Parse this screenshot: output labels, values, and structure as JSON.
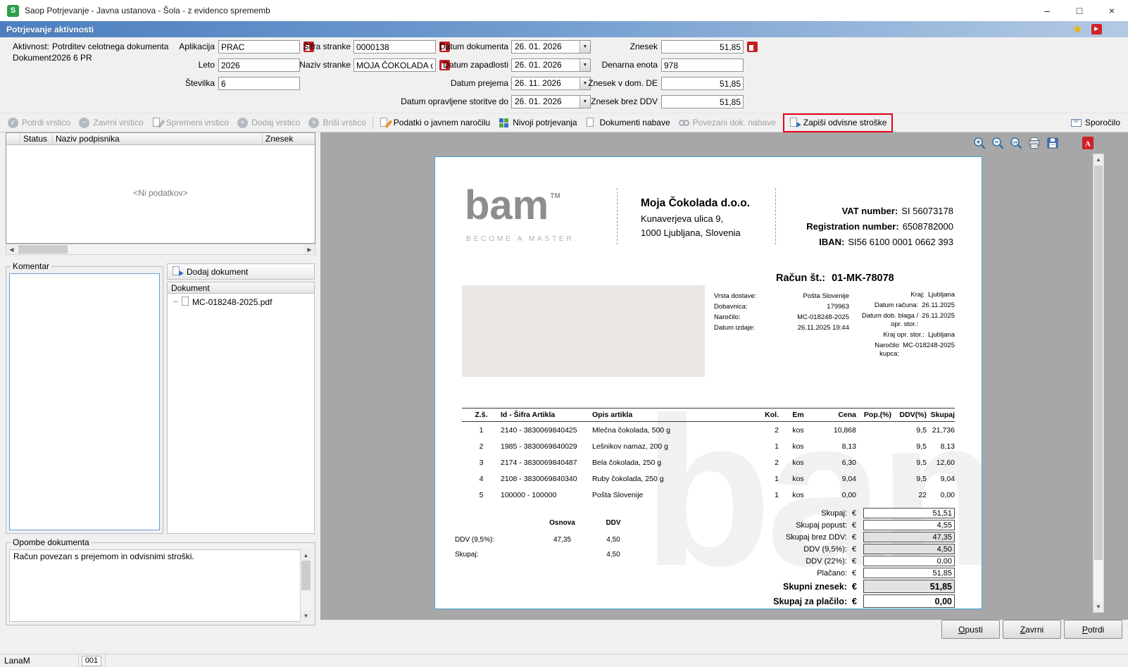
{
  "window": {
    "title": "Saop Potrjevanje - Javna ustanova - Šola - z evidenco sprememb",
    "logo_letter": "S"
  },
  "icons": {
    "minimize": "–",
    "maximize": "□",
    "close": "×",
    "star": "★",
    "dropdown": "▼",
    "check": "✓",
    "minus": "−",
    "plus": "+",
    "cross": "×",
    "up": "▲",
    "down": "▼",
    "left": "◀",
    "right": "▶"
  },
  "activity_bar": {
    "title": "Potrjevanje aktivnosti"
  },
  "form": {
    "aktivnost_label": "Aktivnost:",
    "aktivnost_value": "Potrditev celotnega dokumenta",
    "dokument_label": "Dokument:",
    "dokument_value": "2026 6 PR",
    "aplikacija_label": "Aplikacija",
    "aplikacija_value": "PRAC",
    "leto_label": "Leto",
    "leto_value": "2026",
    "stevilka_label": "Številka",
    "stevilka_value": "6",
    "sifra_stranke_label": "Šifra stranke",
    "sifra_stranke_value": "0000138",
    "naziv_stranke_label": "Naziv stranke",
    "naziv_stranke_value": "MOJA ČOKOLADA d.o.o.",
    "datum_dokumenta_label": "Datum dokumenta",
    "datum_dokumenta_value": "26. 01. 2026",
    "datum_zapadlosti_label": "Datum zapadlosti",
    "datum_zapadlosti_value": "26. 01. 2026",
    "datum_prejema_label": "Datum prejema",
    "datum_prejema_value": "26. 11. 2026",
    "datum_opravljene_label": "Datum opravljene storitve do",
    "datum_opravljene_value": "26. 01. 2026",
    "znesek_label": "Znesek",
    "znesek_value": "51,85",
    "denarna_enota_label": "Denarna enota",
    "denarna_enota_value": "978",
    "znesek_dom_label": "Znesek v dom. DE",
    "znesek_dom_value": "51,85",
    "znesek_brez_ddv_label": "Znesek brez DDV",
    "znesek_brez_ddv_value": "51,85"
  },
  "toolbar": {
    "items": [
      {
        "label": "Potrdi vrstico"
      },
      {
        "label": "Zavrni vrstico"
      },
      {
        "label": "Spremeni vrstico"
      },
      {
        "label": "Dodaj vrstico"
      },
      {
        "label": "Briši vrstico"
      },
      {
        "label": "Podatki o javnem naročilu"
      },
      {
        "label": "Nivoji potrjevanja"
      },
      {
        "label": "Dokumenti nabave"
      },
      {
        "label": "Povezani dok. nabave"
      },
      {
        "label": "Zapiši odvisne stroške"
      }
    ],
    "message_label": "Sporočilo"
  },
  "signers": {
    "columns": [
      "Status",
      "Naziv podpisnika",
      "Znesek"
    ],
    "empty_text": "<Ni podatkov>"
  },
  "komentar": {
    "label": "Komentar",
    "value": ""
  },
  "documents": {
    "add_button_label": "Dodaj dokument",
    "column_header": "Dokument",
    "files": [
      "MC-018248-2025.pdf"
    ]
  },
  "opombe": {
    "label": "Opombe dokumenta",
    "text": "Račun povezan s prejemom in odvisnimi stroški."
  },
  "invoice": {
    "logo": {
      "text": "bam",
      "tm": "TM",
      "tagline": "BECOME A MASTER"
    },
    "supplier": {
      "name": "Moja Čokolada d.o.o.",
      "street": "Kunaverjeva ulica 9,",
      "city": "1000 Ljubljana, Slovenia"
    },
    "registry": [
      {
        "label": "VAT number:",
        "value": "SI 56073178"
      },
      {
        "label": "Registration number:",
        "value": "6508782000"
      },
      {
        "label": "IBAN:",
        "value": "SI56 6100 0001 0662 393"
      }
    ],
    "number_label": "Račun št.:",
    "number": "01-MK-78078",
    "meta_left": [
      {
        "label": "Vrsta dostave:",
        "value": "Pošta Slovenije"
      },
      {
        "label": "Dobavnica:",
        "value": "179963"
      },
      {
        "label": "Naročilo:",
        "value": "MC-018248-2025"
      },
      {
        "label": "Datum izdaje:",
        "value": "26.11.2025 19:44"
      }
    ],
    "meta_right": [
      {
        "label": "Kraj:",
        "value": "Ljubljana"
      },
      {
        "label": "Datum računa:",
        "value": "26.11.2025"
      },
      {
        "label": "Datum dob. blaga / opr. stor.:",
        "value": "26.11.2025"
      },
      {
        "label": "Kraj opr. stor.:",
        "value": "Ljubljana"
      },
      {
        "label": "Naročilo kupca:",
        "value": "MC-018248-2025"
      }
    ],
    "items": {
      "columns": [
        "Z.š.",
        "Id - Šifra Artikla",
        "Opis artikla",
        "Kol.",
        "Em",
        "Cena",
        "Pop.(%)",
        "DDV(%)",
        "Skupaj"
      ],
      "rows": [
        [
          "1",
          "2140 - 3830069840425",
          "Mlečna čokolada, 500 g",
          "2",
          "kos",
          "10,868",
          "",
          "9,5",
          "21,736"
        ],
        [
          "2",
          "1985 - 3830069840029",
          "Lešnikov namaz, 200 g",
          "1",
          "kos",
          "8,13",
          "",
          "9,5",
          "8,13"
        ],
        [
          "3",
          "2174 - 3830069840487",
          "Bela čokolada, 250 g",
          "2",
          "kos",
          "6,30",
          "",
          "9,5",
          "12,60"
        ],
        [
          "4",
          "2108 - 3830069840340",
          "Ruby čokolada, 250 g",
          "1",
          "kos",
          "9,04",
          "",
          "9,5",
          "9,04"
        ],
        [
          "5",
          "100000 - 100000",
          "Pošta Slovenije",
          "1",
          "kos",
          "0,00",
          "",
          "22",
          "0,00"
        ]
      ]
    },
    "vat_table": {
      "osnova_header": "Osnova",
      "ddv_header": "DDV",
      "rows": [
        {
          "label": "DDV (9,5%):",
          "osnova": "47,35",
          "ddv": "4,50"
        },
        {
          "label": "Skupaj:",
          "osnova": "",
          "ddv": "4,50"
        }
      ]
    },
    "totals": [
      {
        "label": "Skupaj:",
        "currency": "€",
        "value": "51,51"
      },
      {
        "label": "Skupaj popust:",
        "currency": "€",
        "value": "4,55"
      },
      {
        "label": "Skupaj brez DDV:",
        "currency": "€",
        "value": "47,35"
      },
      {
        "label": "DDV (9,5%):",
        "currency": "€",
        "value": "4,50"
      },
      {
        "label": "DDV (22%):",
        "currency": "€",
        "value": "0,00"
      },
      {
        "label": "Plačano:",
        "currency": "€",
        "value": "51,85"
      },
      {
        "label": "Skupni znesek:",
        "currency": "€",
        "value": "51,85"
      },
      {
        "label": "Skupaj za plačilo:",
        "currency": "€",
        "value": "0,00"
      }
    ]
  },
  "footer": {
    "buttons": [
      {
        "accel": "O",
        "rest": "pusti"
      },
      {
        "accel": "Z",
        "rest": "avrni"
      },
      {
        "accel": "P",
        "rest": "otrdi"
      }
    ]
  },
  "statusbar": {
    "user": "LanaM",
    "code": "001"
  }
}
